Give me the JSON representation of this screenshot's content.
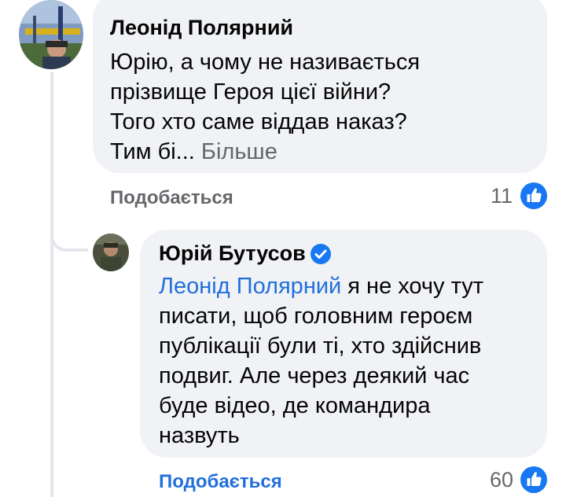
{
  "comments": [
    {
      "author": "Леонід Полярний",
      "avatar_icon": "avatar-photo-icon",
      "text_lines": [
        "Юрію, а чому не називається",
        "прізвище Героя цієї війни?",
        "Того хто саме віддав наказ?",
        "Тим бі..."
      ],
      "more_label": "Більше",
      "like_label": "Подобається",
      "reaction_count": "11",
      "reaction_icon": "thumbs-up-icon"
    },
    {
      "author": "Юрій Бутусов",
      "avatar_icon": "avatar-photo-icon",
      "verified_icon": "verified-badge-icon",
      "mention": "Леонід Полярний",
      "text_lines": [
        " я не хочу тут",
        "писати, щоб головним героєм",
        "публікації були ті, хто здійснив",
        "подвиг. Але через деякий час",
        "буде відео, де командира",
        "назвуть"
      ],
      "like_label": "Подобається",
      "reaction_count": "60",
      "reaction_icon": "thumbs-up-icon"
    }
  ],
  "colors": {
    "bubble_bg": "#f0f2f5",
    "secondary_text": "#65676b",
    "link_blue": "#216fdb",
    "like_blue": "#1877f2"
  }
}
